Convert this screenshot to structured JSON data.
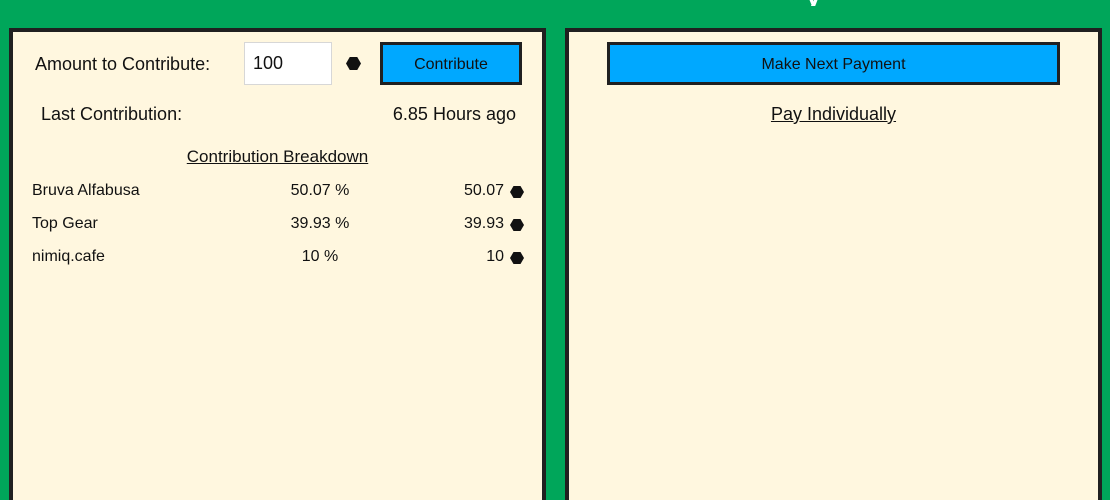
{
  "colors": {
    "background": "#00a65a",
    "panel": "#fff7df",
    "border": "#202020",
    "button": "#00a8ff"
  },
  "title_fragment": "y",
  "contribute_panel": {
    "amount_label": "Amount to Contribute:",
    "amount_value": "100",
    "currency_icon": "hexagon-coin-icon",
    "contribute_button": "Contribute",
    "last_contribution_label": "Last Contribution:",
    "last_contribution_value": "6.85 Hours ago",
    "breakdown_title": "Contribution Breakdown",
    "breakdown": [
      {
        "name": "Bruva Alfabusa",
        "percent": "50.07 %",
        "amount": "50.07"
      },
      {
        "name": "Top Gear",
        "percent": "39.93 %",
        "amount": "39.93"
      },
      {
        "name": "nimiq.cafe",
        "percent": "10 %",
        "amount": "10"
      }
    ]
  },
  "payment_panel": {
    "next_payment_button": "Make Next Payment",
    "pay_individually_link": "Pay Individually"
  }
}
